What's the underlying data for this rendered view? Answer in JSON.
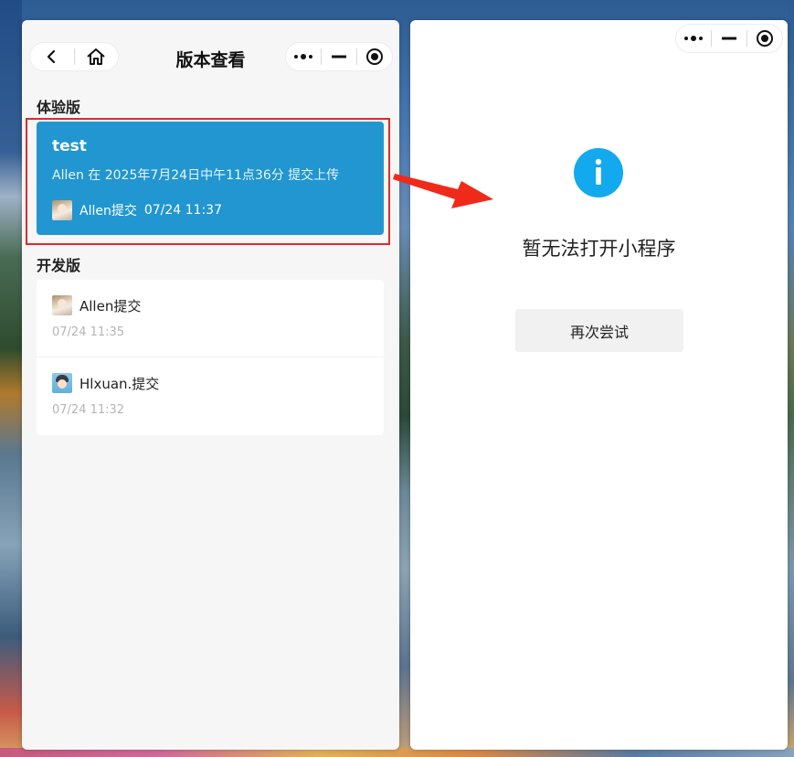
{
  "left_window": {
    "title": "版本查看",
    "experience_section": {
      "heading": "体验版",
      "card": {
        "name": "test",
        "description": "Allen 在 2025年7月24日中午11点36分 提交上传",
        "submitter": "Allen提交",
        "time": "07/24 11:37"
      }
    },
    "dev_section": {
      "heading": "开发版",
      "items": [
        {
          "submitter": "Allen提交",
          "time": "07/24 11:35",
          "avatar": "avatar-allen"
        },
        {
          "submitter": "Hlxuan.提交",
          "time": "07/24 11:32",
          "avatar": "avatar-hlxuan"
        }
      ]
    }
  },
  "right_window": {
    "message": "暂无法打开小程序",
    "retry_label": "再次尝试"
  },
  "icons": {
    "back": "chevron-left-icon",
    "home": "home-icon",
    "more": "more-dots-icon",
    "minimize": "minimize-icon",
    "close": "record-close-icon",
    "info": "info-icon"
  },
  "colors": {
    "card_blue": "#2196d0",
    "info_blue": "#12a9ef",
    "highlight_red": "#e02a2a",
    "arrow_red": "#f02a1a"
  }
}
